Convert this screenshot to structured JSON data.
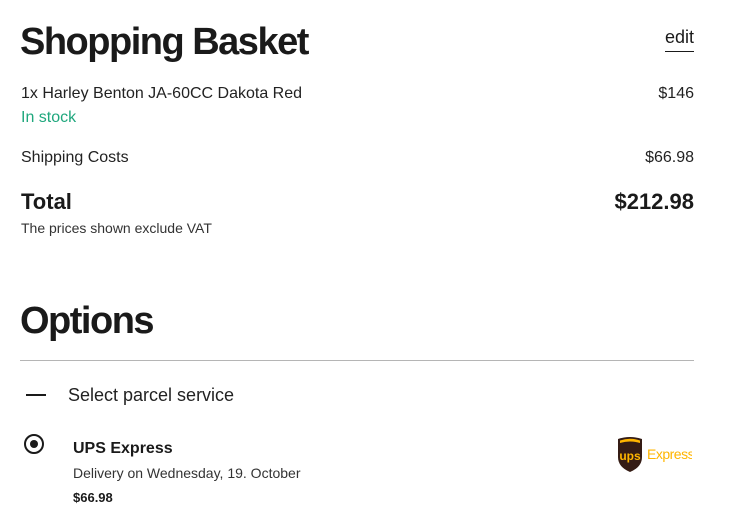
{
  "basket": {
    "title": "Shopping Basket",
    "edit_label": "edit",
    "item": {
      "name": "1x Harley Benton JA-60CC Dakota Red",
      "price": "$146",
      "stock": "In stock"
    },
    "shipping": {
      "label": "Shipping Costs",
      "price": "$66.98"
    },
    "total": {
      "label": "Total",
      "value": "$212.98"
    },
    "vat_note": "The prices shown exclude VAT"
  },
  "options": {
    "title": "Options",
    "section_label": "Select parcel service",
    "service": {
      "name": "UPS Express",
      "delivery": "Delivery on Wednesday, 19. October",
      "price": "$66.98",
      "selected": true,
      "logo_text_ups": "ups",
      "logo_text_express": "Express"
    }
  },
  "colors": {
    "in_stock": "#1fa77d",
    "ups_brown": "#351c15",
    "ups_gold": "#ffb500",
    "divider": "#b5b5b5"
  }
}
